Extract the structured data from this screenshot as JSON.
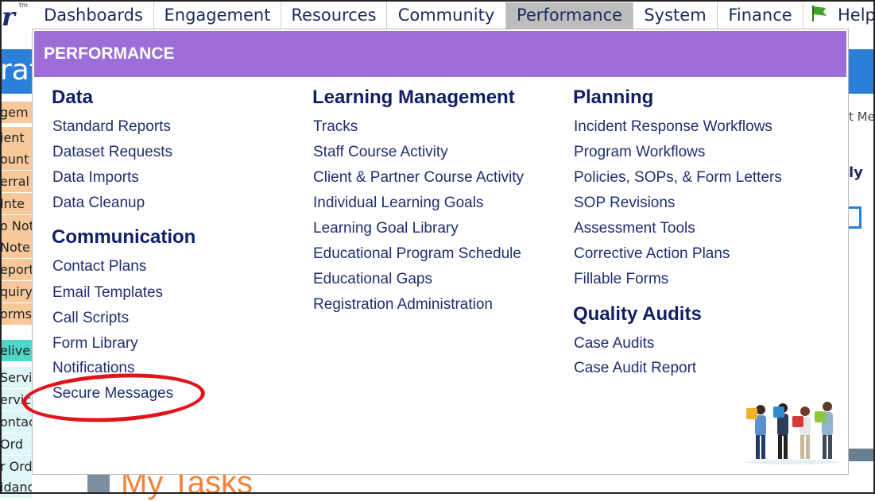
{
  "nav": {
    "logo": "r",
    "logo_tm": "tm",
    "items": [
      {
        "label": "Dashboards"
      },
      {
        "label": "Engagement"
      },
      {
        "label": "Resources"
      },
      {
        "label": "Community"
      },
      {
        "label": "Performance",
        "active": true
      },
      {
        "label": "System"
      },
      {
        "label": "Finance"
      },
      {
        "label": "Help"
      }
    ]
  },
  "background": {
    "banner_fragment": "rat",
    "left_rows": [
      "gem",
      "ient",
      "ount",
      "erral",
      "Inte",
      "o Not",
      "Note",
      "eport",
      "quiry",
      "orms",
      "elive",
      "Servi",
      "ervic",
      "ontac",
      "Ord",
      "r Ord",
      "idance"
    ],
    "right_fragments": [
      "t Me",
      "ly"
    ],
    "my_tasks": "My Tasks"
  },
  "menu": {
    "header": "PERFORMANCE",
    "columns": [
      {
        "sections": [
          {
            "title": "Data",
            "links": [
              "Standard Reports",
              "Dataset Requests",
              "Data Imports",
              "Data Cleanup"
            ]
          },
          {
            "title": "Communication",
            "links": [
              "Contact Plans",
              "Email Templates",
              "Call Scripts",
              "Form Library",
              "Notifications",
              "Secure Messages"
            ]
          }
        ]
      },
      {
        "sections": [
          {
            "title": "Learning Management",
            "links": [
              "Tracks",
              "Staff Course Activity",
              "Client & Partner Course Activity",
              "Individual Learning Goals",
              "Learning Goal Library",
              "Educational Program Schedule",
              "Educational Gaps",
              "Registration Administration"
            ]
          }
        ]
      },
      {
        "sections": [
          {
            "title": "Planning",
            "links": [
              "Incident Response Workflows",
              "Program Workflows",
              "Policies, SOPs, & Form Letters",
              "SOP Revisions",
              "Assessment Tools",
              "Corrective Action Plans",
              "Fillable Forms"
            ]
          },
          {
            "title": "Quality Audits",
            "links": [
              "Case Audits",
              "Case Audit Report"
            ]
          }
        ]
      }
    ]
  },
  "colors": {
    "header_purple": "#9d6ed8",
    "annotation_red": "#e0141a",
    "title_navy": "#0f1f66"
  }
}
